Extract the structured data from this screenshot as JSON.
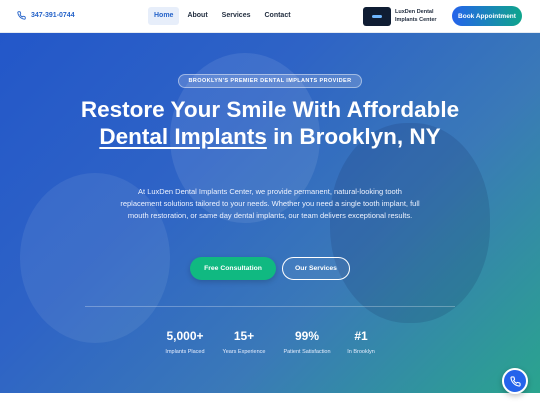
{
  "header": {
    "phone": "347-391-0744",
    "phone_icon": "phone-icon",
    "nav": [
      {
        "label": "Home"
      },
      {
        "label": "About"
      },
      {
        "label": "Services"
      },
      {
        "label": "Contact"
      }
    ],
    "active_nav": "Home",
    "logo_text": "LuxDen Dental Implants Center",
    "cta_label": "Book Appointment"
  },
  "hero": {
    "badge": "BROOKLYN'S PREMIER DENTAL IMPLANTS PROVIDER",
    "title_part1": "Restore Your Smile With Affordable ",
    "title_highlight": "Dental Implants",
    "title_part2": " in Brooklyn, NY",
    "description": "At LuxDen Dental Implants Center, we provide permanent, natural-looking tooth replacement solutions tailored to your needs. Whether you need a single tooth implant, full mouth restoration, or same day dental implants, our team delivers exceptional results.",
    "primary_cta": "Free Consultation",
    "secondary_cta": "Our Services",
    "stats": [
      {
        "value": "5,000+",
        "label": "Implants Placed"
      },
      {
        "value": "15+",
        "label": "Years Experience"
      },
      {
        "value": "99%",
        "label": "Patient Satisfaction"
      },
      {
        "value": "#1",
        "label": "In Brooklyn"
      }
    ]
  },
  "floating_button": {
    "icon": "phone-icon"
  },
  "colors": {
    "brand_blue": "#2563eb",
    "accent_green": "#10b981",
    "text_dark": "#1f2b3d",
    "logo_bg": "#0f1d33"
  }
}
